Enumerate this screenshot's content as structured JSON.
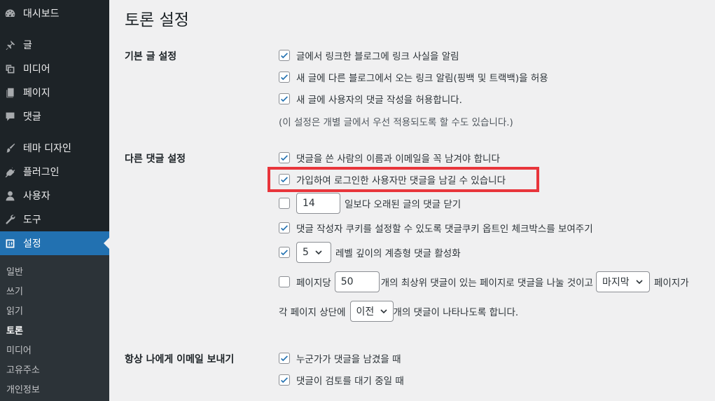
{
  "sidebar": {
    "items": [
      {
        "label": "대시보드",
        "icon": "dashboard-icon"
      },
      {
        "label": "글",
        "icon": "pin-icon"
      },
      {
        "label": "미디어",
        "icon": "media-icon"
      },
      {
        "label": "페이지",
        "icon": "page-icon"
      },
      {
        "label": "댓글",
        "icon": "comment-icon"
      },
      {
        "label": "테마 디자인",
        "icon": "brush-icon"
      },
      {
        "label": "플러그인",
        "icon": "plugin-icon"
      },
      {
        "label": "사용자",
        "icon": "user-icon"
      },
      {
        "label": "도구",
        "icon": "wrench-icon"
      },
      {
        "label": "설정",
        "icon": "settings-icon"
      }
    ],
    "submenu": [
      "일반",
      "쓰기",
      "읽기",
      "토론",
      "미디어",
      "고유주소",
      "개인정보"
    ]
  },
  "page": {
    "title": "토론 설정"
  },
  "sections": {
    "default_post": {
      "label": "기본 글 설정",
      "options": [
        "글에서 링크한 블로그에 링크 사실을 알림",
        "새 글에 다른 블로그에서 오는 링크 알림(핑백 및 트랙백)을 허용",
        "새 글에 사용자의 댓글 작성을 허용합니다."
      ],
      "note": "(이 설정은 개별 글에서 우선 적용되도록 할 수도 있습니다.)"
    },
    "other_comment": {
      "label": "다른 댓글 설정",
      "opt_require_name": "댓글을 쓴 사람의 이름과 이메일을 꼭 남겨야 합니다",
      "opt_registered": "가입하여 로그인한 사용자만 댓글을 남길 수 있습니다",
      "close_days_value": "14",
      "close_days_text": "일보다 오래된 글의 댓글 닫기",
      "opt_cookies": "댓글 작성자 쿠키를 설정할 수 있도록 댓글쿠키 옵트인 체크박스를 보여주기",
      "thread_depth": "5",
      "thread_text": "레벨 깊이의 계층형 댓글 활성화",
      "paginate_prefix": "페이지당",
      "per_page": "50",
      "paginate_mid": "개의 최상위 댓글이 있는 페이지로 댓글을 나눌 것이고",
      "paginate_select": "마지막",
      "paginate_suffix": "페이지가",
      "order_prefix": "각 페이지 상단에",
      "order_select": "이전",
      "order_suffix": "개의 댓글이 나타나도록 합니다."
    },
    "email": {
      "label": "항상 나에게 이메일 보내기",
      "opt_anyone": "누군가가 댓글을 남겼을 때",
      "opt_moderation": "댓글이 검토를 대기 중일 때"
    }
  },
  "colors": {
    "accent": "#2271b1",
    "highlight": "#e8353b",
    "sidebar": "#1d2327"
  }
}
